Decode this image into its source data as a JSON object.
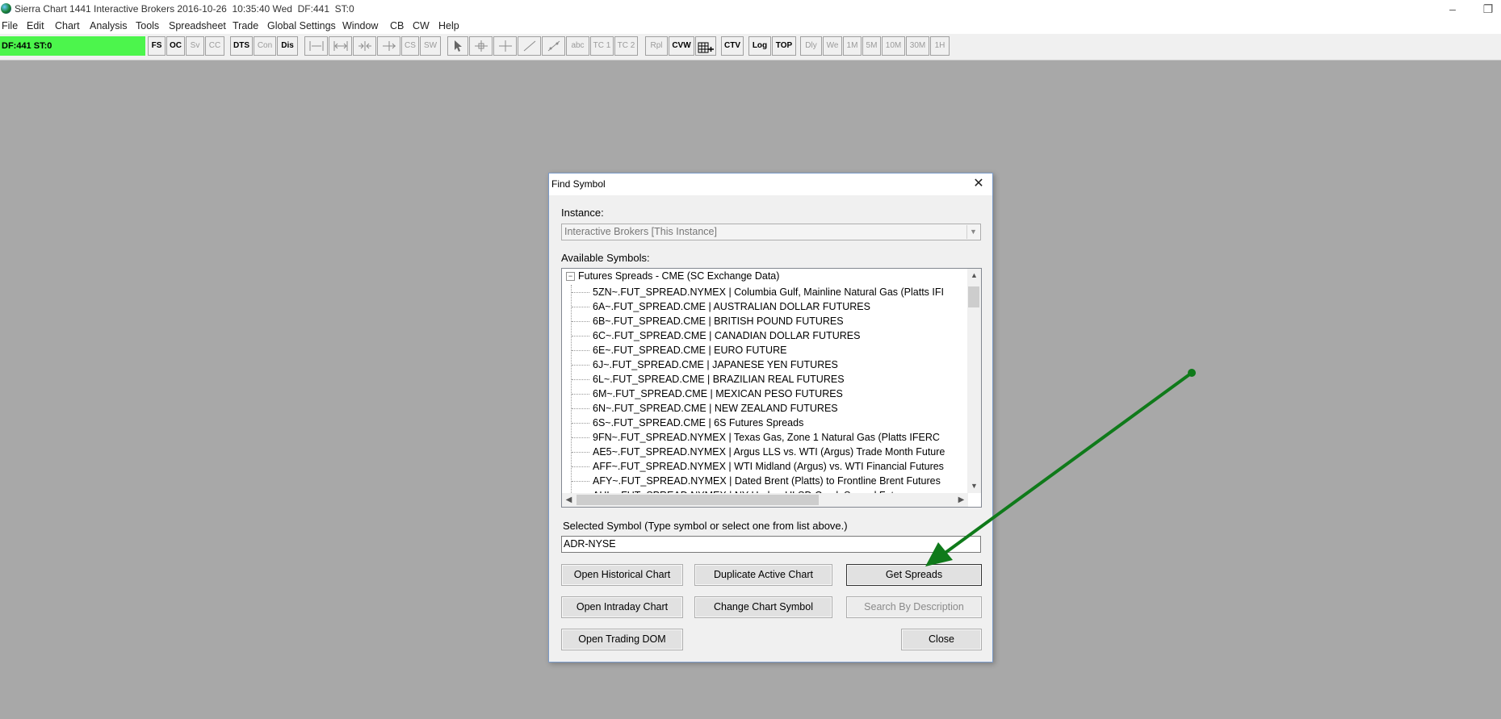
{
  "titlebar": {
    "title": "Sierra Chart 1441 Interactive Brokers 2016-10-26  10:35:40 Wed  DF:441  ST:0"
  },
  "menubar": {
    "items": [
      "File",
      "Edit",
      "Chart",
      "Analysis",
      "Tools",
      "Spreadsheet",
      "Trade",
      "Global Settings",
      "Window",
      "CB",
      "CW",
      "Help"
    ]
  },
  "toolbar": {
    "status": "DF:441  ST:0",
    "buttons": [
      "FS",
      "OC",
      "Sv",
      "CC",
      "DTS",
      "Con",
      "Dis",
      "CS",
      "SW",
      "abc",
      "TC 1",
      "TC 2",
      "Rpl",
      "CVW",
      "CTV",
      "Log",
      "TOP",
      "Dly",
      "We",
      "1M",
      "5M",
      "10M",
      "30M",
      "1H"
    ]
  },
  "dialog": {
    "title": "Find Symbol",
    "instance_label": "Instance:",
    "instance_value": "Interactive Brokers [This Instance]",
    "available_label": "Available Symbols:",
    "tree_root": "Futures Spreads - CME (SC Exchange Data)",
    "symbols": [
      "5ZN~.FUT_SPREAD.NYMEX  |  Columbia Gulf, Mainline Natural Gas (Platts IFI",
      "6A~.FUT_SPREAD.CME  |  AUSTRALIAN DOLLAR FUTURES",
      "6B~.FUT_SPREAD.CME  |  BRITISH POUND FUTURES",
      "6C~.FUT_SPREAD.CME  |  CANADIAN DOLLAR FUTURES",
      "6E~.FUT_SPREAD.CME  |  EURO FUTURE",
      "6J~.FUT_SPREAD.CME  |  JAPANESE YEN FUTURES",
      "6L~.FUT_SPREAD.CME  |  BRAZILIAN REAL FUTURES",
      "6M~.FUT_SPREAD.CME  |  MEXICAN PESO FUTURES",
      "6N~.FUT_SPREAD.CME  |  NEW ZEALAND FUTURES",
      "6S~.FUT_SPREAD.CME  |  6S Futures Spreads",
      "9FN~.FUT_SPREAD.NYMEX  |  Texas Gas, Zone 1 Natural Gas (Platts IFERC",
      "AE5~.FUT_SPREAD.NYMEX  |  Argus LLS vs. WTI (Argus) Trade Month Future",
      "AFF~.FUT_SPREAD.NYMEX  |  WTI Midland (Argus) vs. WTI Financial Futures",
      "AFY~.FUT_SPREAD.NYMEX  |  Dated Brent (Platts) to Frontline Brent Futures",
      "AHL~.FUT_SPREAD.NYMEX  |  NY Harbor ULSD Crack Spread Futures"
    ],
    "selected_label": "Selected Symbol (Type symbol or select one from list above.)",
    "selected_value": "ADR-NYSE",
    "buttons": {
      "open_historical": "Open Historical Chart",
      "duplicate_active": "Duplicate Active Chart",
      "get_spreads": "Get Spreads",
      "open_intraday": "Open Intraday Chart",
      "change_symbol": "Change Chart Symbol",
      "search_description": "Search By Description",
      "open_dom": "Open Trading DOM",
      "close": "Close"
    }
  },
  "colors": {
    "desktop": "#a8a8a8",
    "status_green": "#4cf54c",
    "annotation_arrow": "#0f7a1a"
  }
}
